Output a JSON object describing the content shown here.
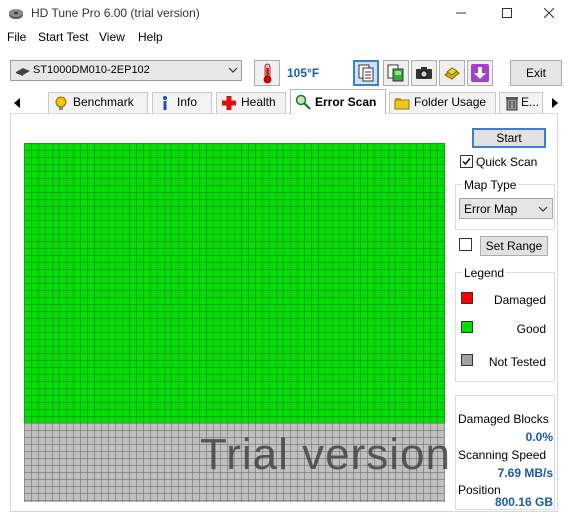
{
  "window": {
    "title": "HD Tune Pro 6.00 (trial version)",
    "controls": [
      "minimize",
      "maximize",
      "close"
    ]
  },
  "menu": [
    "File",
    "Start Test",
    "View",
    "Help"
  ],
  "toolbar": {
    "drive": "ST1000DM010-2EP102",
    "temperature": "105°F",
    "exit_label": "Exit",
    "icons": [
      "thermometer-icon",
      "copy-text-icon",
      "copy-screenshot-icon",
      "camera-icon",
      "save-icon",
      "download-icon"
    ]
  },
  "tabs": [
    {
      "label": "Benchmark",
      "icon": "benchmark-icon"
    },
    {
      "label": "Info",
      "icon": "info-icon"
    },
    {
      "label": "Health",
      "icon": "health-icon"
    },
    {
      "label": "Error Scan",
      "icon": "magnifier-icon",
      "active": true
    },
    {
      "label": "Folder Usage",
      "icon": "folder-icon"
    },
    {
      "label": "E...",
      "icon": "trash-icon"
    }
  ],
  "scan": {
    "start_label": "Start",
    "quick_scan_label": "Quick Scan",
    "quick_scan_checked": true,
    "map_type_title": "Map Type",
    "map_type_value": "Error Map",
    "set_range_label": "Set Range",
    "set_range_checked": false,
    "progress_fraction": 0.78,
    "watermark": "Trial version"
  },
  "legend": {
    "title": "Legend",
    "items": [
      {
        "label": "Damaged",
        "color": "#ff0000"
      },
      {
        "label": "Good",
        "color": "#00e000"
      },
      {
        "label": "Not Tested",
        "color": "#a0a0a0"
      }
    ]
  },
  "stats": {
    "damaged_label": "Damaged Blocks",
    "damaged_value": "0.0%",
    "speed_label": "Scanning Speed",
    "speed_value": "7.69 MB/s",
    "position_label": "Position",
    "position_value": "800.16 GB"
  },
  "colors": {
    "good": "#00e000",
    "not_tested": "#c0c0c0",
    "accent_text": "#1a5aa8"
  }
}
